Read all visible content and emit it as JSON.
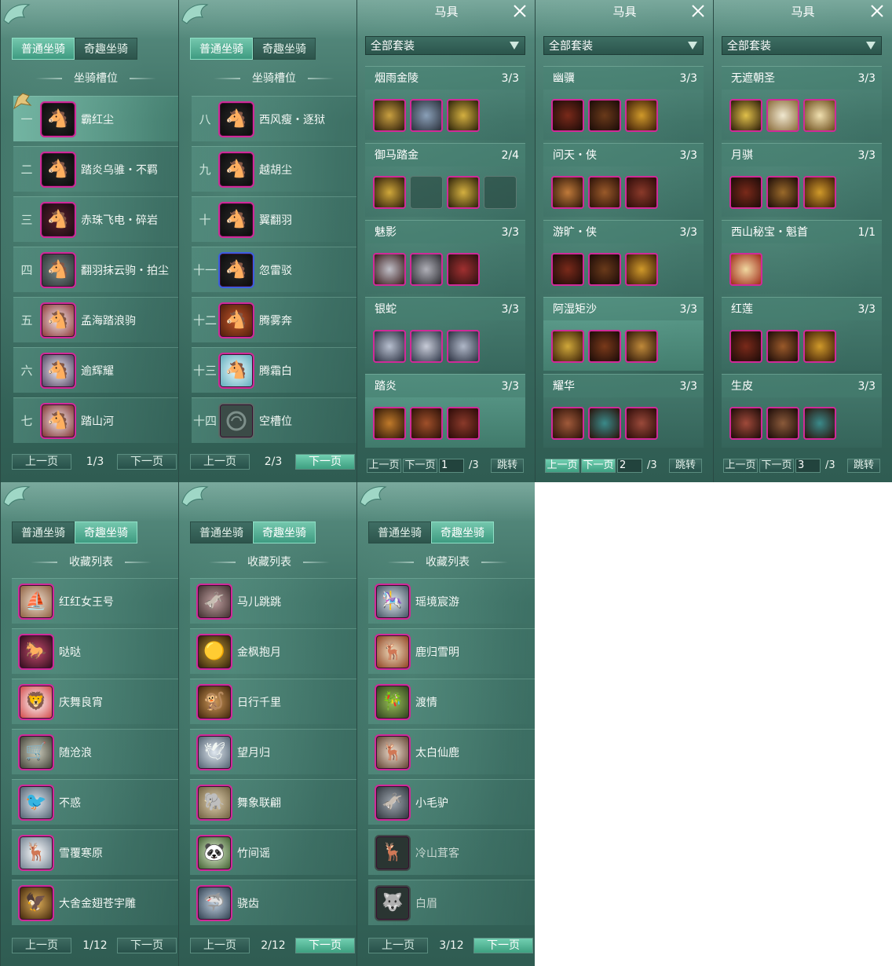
{
  "tabs": {
    "normal": "普通坐骑",
    "fun": "奇趣坐骑"
  },
  "slot_header": "坐骑槽位",
  "collection_header": "收藏列表",
  "pager": {
    "prev": "上一页",
    "next": "下一页",
    "jump": "跳转"
  },
  "mount_pages": [
    {
      "page": "1/3",
      "rows": [
        {
          "num": "一",
          "name": "霸红尘",
          "icon": "black-horse-icon",
          "selected": true
        },
        {
          "num": "二",
          "name": "踏炎乌骓・不羁",
          "icon": "black-horse-icon"
        },
        {
          "num": "三",
          "name": "赤珠飞电・碎岩",
          "icon": "red-horse-icon"
        },
        {
          "num": "四",
          "name": "翻羽抹云驹・拍尘",
          "icon": "grey-horse-icon"
        },
        {
          "num": "五",
          "name": "孟海踏浪驹",
          "icon": "white-horse-icon"
        },
        {
          "num": "六",
          "name": "逾辉耀",
          "icon": "white-horse-icon"
        },
        {
          "num": "七",
          "name": "踏山河",
          "icon": "white-horse-icon"
        }
      ]
    },
    {
      "page": "2/3",
      "rows": [
        {
          "num": "八",
          "name": "西风瘦・逐狱",
          "icon": "black-horse-icon"
        },
        {
          "num": "九",
          "name": "越胡尘",
          "icon": "black-horse-icon"
        },
        {
          "num": "十",
          "name": "翼翻羽",
          "icon": "black-horse-icon"
        },
        {
          "num": "十一",
          "name": "忽雷驳",
          "icon": "black-horse-icon",
          "blue": true
        },
        {
          "num": "十二",
          "name": "腾雾奔",
          "icon": "brown-horse-icon"
        },
        {
          "num": "十三",
          "name": "腾霜白",
          "icon": "white-horse-icon"
        },
        {
          "num": "十四",
          "name": "空槽位",
          "icon": "empty-slot-icon",
          "empty": true
        }
      ]
    }
  ],
  "tack": {
    "title": "马具",
    "filter": "全部套装",
    "pages": [
      {
        "page": "1",
        "total": "/3",
        "sets": [
          {
            "name": "烟雨金陵",
            "count": "3/3",
            "pieces": 3,
            "slots": 0
          },
          {
            "name": "御马踏金",
            "count": "2/4",
            "pieces": 2,
            "slots": 2
          },
          {
            "name": "魅影",
            "count": "3/3",
            "pieces": 3,
            "slots": 0
          },
          {
            "name": "银蛇",
            "count": "3/3",
            "pieces": 3,
            "slots": 0
          },
          {
            "name": "踏炎",
            "count": "3/3",
            "pieces": 3,
            "slots": 0,
            "selected": true
          }
        ]
      },
      {
        "page": "2",
        "total": "/3",
        "sets": [
          {
            "name": "幽骥",
            "count": "3/3",
            "pieces": 3,
            "slots": 0
          },
          {
            "name": "问天・侠",
            "count": "3/3",
            "pieces": 3,
            "slots": 0
          },
          {
            "name": "游旷・侠",
            "count": "3/3",
            "pieces": 3,
            "slots": 0
          },
          {
            "name": "阿湿矩沙",
            "count": "3/3",
            "pieces": 3,
            "slots": 0,
            "selected": true
          },
          {
            "name": "耀华",
            "count": "3/3",
            "pieces": 3,
            "slots": 0
          }
        ]
      },
      {
        "page": "3",
        "total": "/3",
        "sets": [
          {
            "name": "无遮朝圣",
            "count": "3/3",
            "pieces": 3,
            "slots": 0
          },
          {
            "name": "月骐",
            "count": "3/3",
            "pieces": 3,
            "slots": 0
          },
          {
            "name": "西山秘宝・魁首",
            "count": "1/1",
            "pieces": 1,
            "slots": 0
          },
          {
            "name": "红莲",
            "count": "3/3",
            "pieces": 3,
            "slots": 0
          },
          {
            "name": "生皮",
            "count": "3/3",
            "pieces": 3,
            "slots": 0
          }
        ]
      }
    ]
  },
  "collection_pages": [
    {
      "page": "1/12",
      "rows": [
        {
          "name": "红红女王号",
          "icon": "ship-icon"
        },
        {
          "name": "哒哒",
          "icon": "rider-icon"
        },
        {
          "name": "庆舞良宵",
          "icon": "lion-dance-icon"
        },
        {
          "name": "随沧浪",
          "icon": "cart-icon"
        },
        {
          "name": "不惑",
          "icon": "bird-icon"
        },
        {
          "name": "雪覆寒原",
          "icon": "white-deer-icon"
        },
        {
          "name": "大舍金翅苍宇雕",
          "icon": "eagle-icon"
        }
      ]
    },
    {
      "page": "2/12",
      "rows": [
        {
          "name": "马儿跳跳",
          "icon": "donkey-icon"
        },
        {
          "name": "金枫抱月",
          "icon": "golden-ball-icon"
        },
        {
          "name": "日行千里",
          "icon": "monkey-icon"
        },
        {
          "name": "望月归",
          "icon": "crane-icon"
        },
        {
          "name": "舞象联翩",
          "icon": "elephant-icon"
        },
        {
          "name": "竹间谣",
          "icon": "panda-icon"
        },
        {
          "name": "骁齿",
          "icon": "shark-icon"
        }
      ]
    },
    {
      "page": "3/12",
      "rows": [
        {
          "name": "瑶境宸游",
          "icon": "carriage-icon"
        },
        {
          "name": "鹿归雪明",
          "icon": "deer-icon"
        },
        {
          "name": "渡情",
          "icon": "bamboo-raft-icon"
        },
        {
          "name": "太白仙鹿",
          "icon": "antler-deer-icon"
        },
        {
          "name": "小毛驴",
          "icon": "donkey-icon"
        },
        {
          "name": "冷山茸客",
          "icon": "locked-deer-icon",
          "dim": true
        },
        {
          "name": "白眉",
          "icon": "locked-wolf-icon",
          "dim": true
        }
      ]
    }
  ],
  "colors": {
    "accent": "#3ea081",
    "frame": "#d02a98",
    "panel": "#3a6b60"
  }
}
